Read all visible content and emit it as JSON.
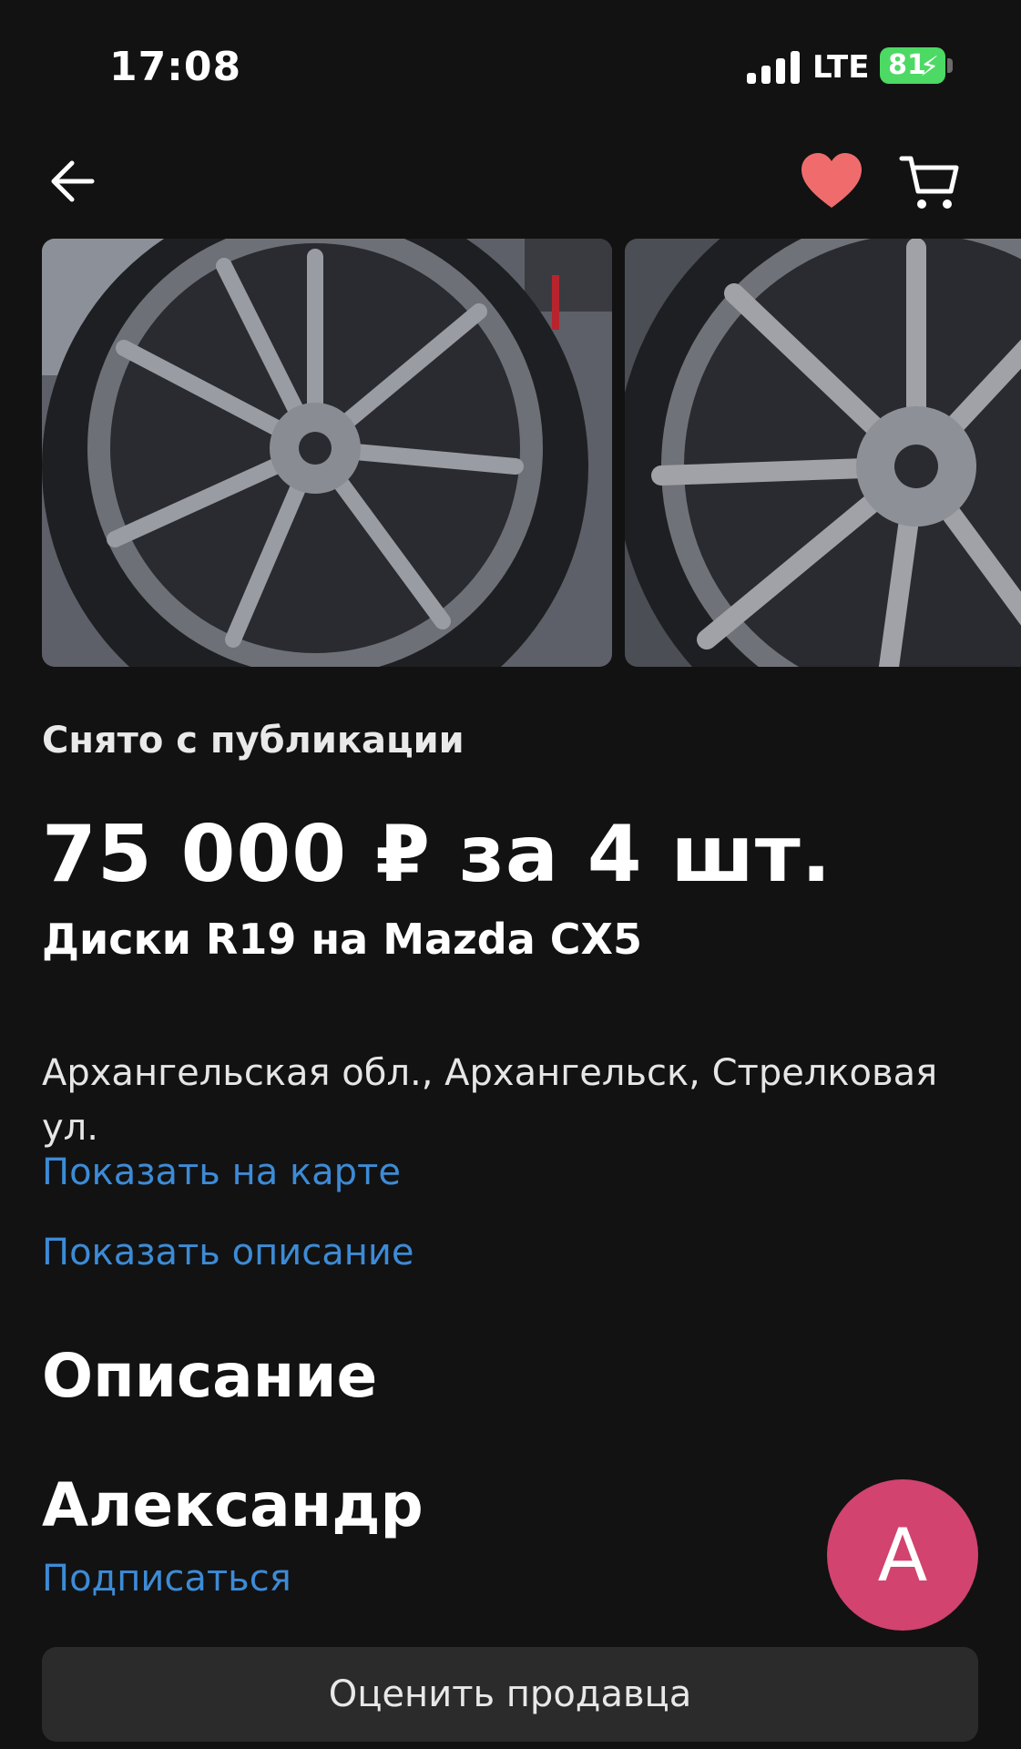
{
  "status_bar": {
    "time": "17:08",
    "network": "LTE",
    "battery": "81"
  },
  "header": {
    "icons": [
      "back-arrow-icon",
      "heart-icon",
      "cart-icon"
    ],
    "heart_color": "#f06c6c"
  },
  "listing": {
    "status": "Снято с публикации",
    "price": "75 000 ₽ за 4 шт.",
    "title": "Диски R19 на Mazda CX5",
    "address": "Архангельская обл., Архангельск, Стрелковая ул.",
    "show_on_map": "Показать на карте",
    "show_description": "Показать описание",
    "description_heading": "Описание"
  },
  "seller": {
    "name": "Александр",
    "subscribe_label": "Подписаться",
    "avatar_letter": "А",
    "avatar_color": "#d2436f",
    "rate_button": "Оценить продавца"
  },
  "colors": {
    "background": "#121212",
    "link": "#3d8bd6",
    "battery": "#4cd964"
  }
}
